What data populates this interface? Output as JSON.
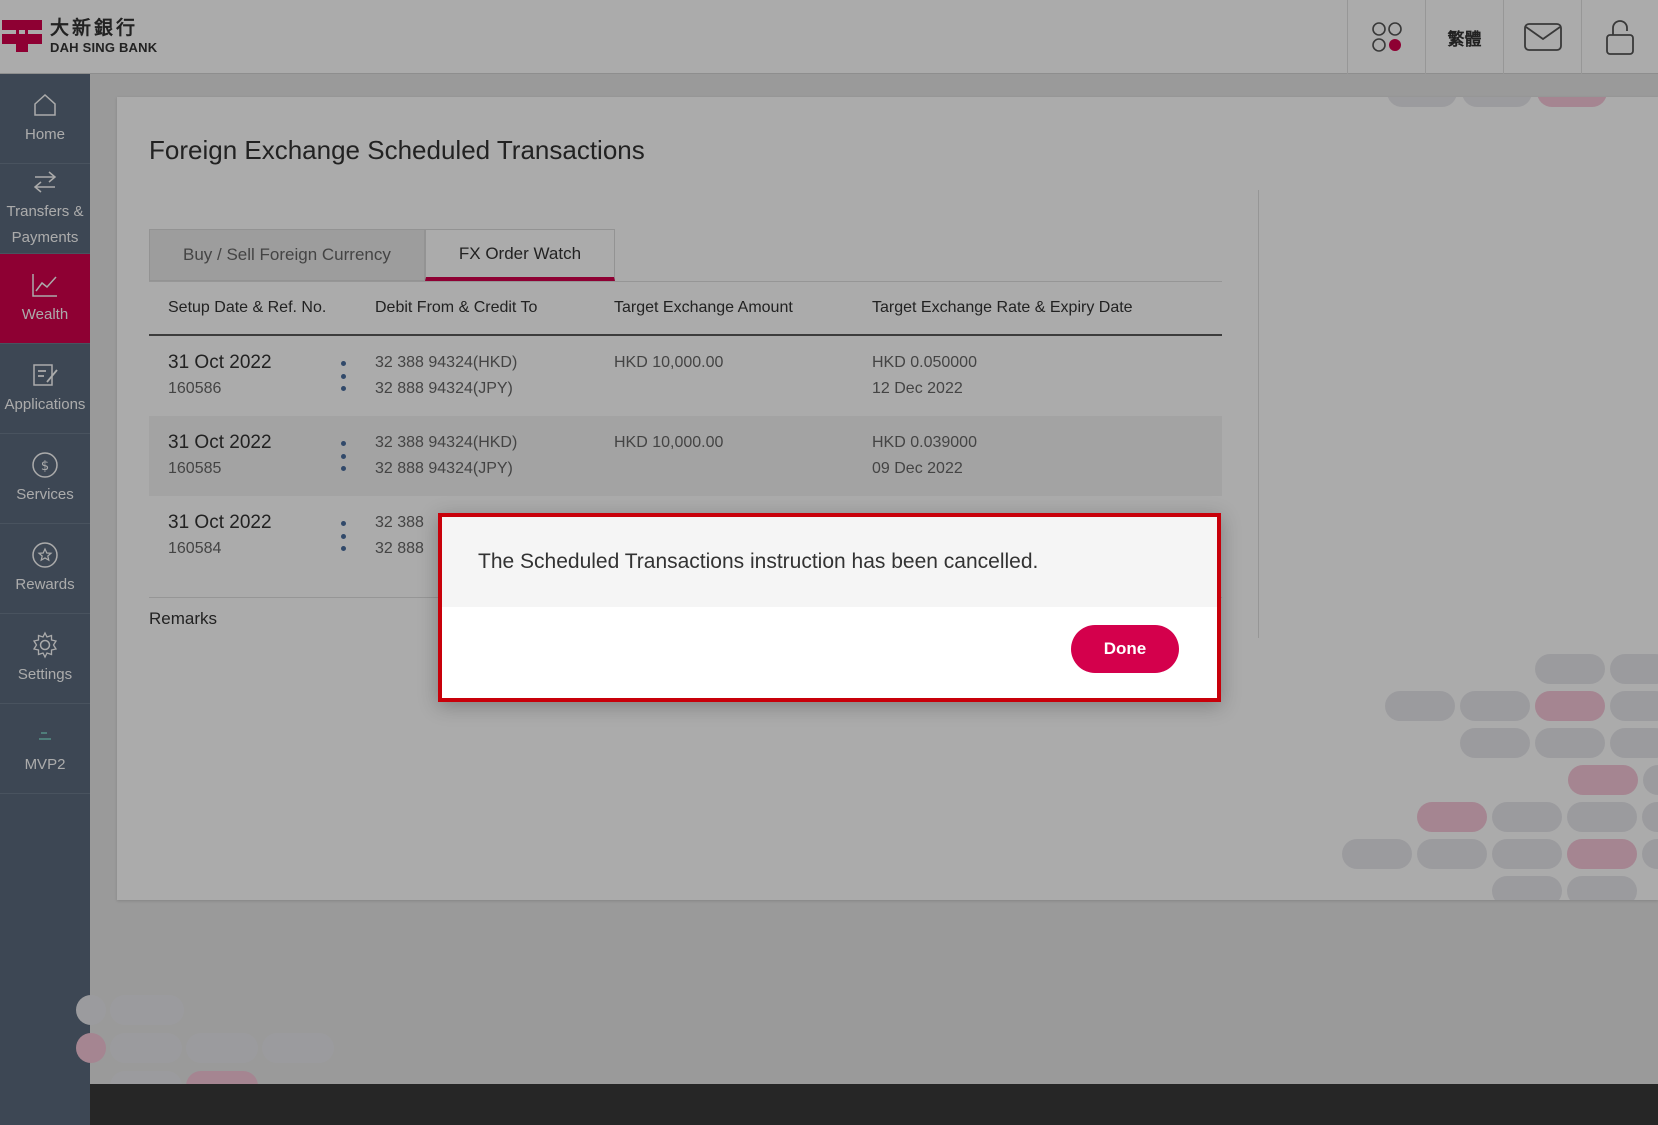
{
  "colors": {
    "brand": "#d4004c",
    "sidebar": "#5c6b7e",
    "modal_border": "#c8000a"
  },
  "header": {
    "logo_cn": "大新銀行",
    "logo_en": "DAH SING BANK",
    "language_label": "繁體",
    "icons": [
      "apps-icon",
      "mail-icon",
      "lock-icon"
    ]
  },
  "sidebar": {
    "items": [
      {
        "label": "Home",
        "icon": "home-icon"
      },
      {
        "label": "Transfers & Payments",
        "icon": "transfer-icon"
      },
      {
        "label": "Wealth",
        "icon": "chart-icon",
        "active": true
      },
      {
        "label": "Applications",
        "icon": "form-edit-icon"
      },
      {
        "label": "Services",
        "icon": "dollar-icon"
      },
      {
        "label": "Rewards",
        "icon": "star-icon"
      },
      {
        "label": "Settings",
        "icon": "gear-icon"
      },
      {
        "label": "MVP2",
        "icon": "mvp-icon"
      }
    ]
  },
  "page": {
    "title": "Foreign Exchange Scheduled Transactions",
    "tabs": [
      {
        "label": "Buy / Sell Foreign Currency",
        "active": false
      },
      {
        "label": "FX Order Watch",
        "active": true
      }
    ],
    "table": {
      "headers": [
        "Setup Date & Ref. No.",
        "Debit From & Credit To",
        "Target Exchange Amount",
        "Target Exchange Rate & Expiry Date"
      ],
      "rows": [
        {
          "date": "31 Oct 2022",
          "ref": "160586",
          "debit": "32 388 94324(HKD)",
          "credit": "32 888 94324(JPY)",
          "amount": "HKD 10,000.00",
          "rate": "HKD 0.050000",
          "expiry": "12 Dec 2022"
        },
        {
          "date": "31 Oct 2022",
          "ref": "160585",
          "debit": "32 388 94324(HKD)",
          "credit": "32 888 94324(JPY)",
          "amount": "HKD 10,000.00",
          "rate": "HKD 0.039000",
          "expiry": "09 Dec 2022"
        },
        {
          "date": "31 Oct 2022",
          "ref": "160584",
          "debit": "32 388",
          "credit": "32 888",
          "amount": "",
          "rate": "",
          "expiry": ""
        }
      ]
    },
    "remarks_label": "Remarks"
  },
  "modal": {
    "message": "The Scheduled Transactions instruction has been cancelled.",
    "done_label": "Done"
  }
}
